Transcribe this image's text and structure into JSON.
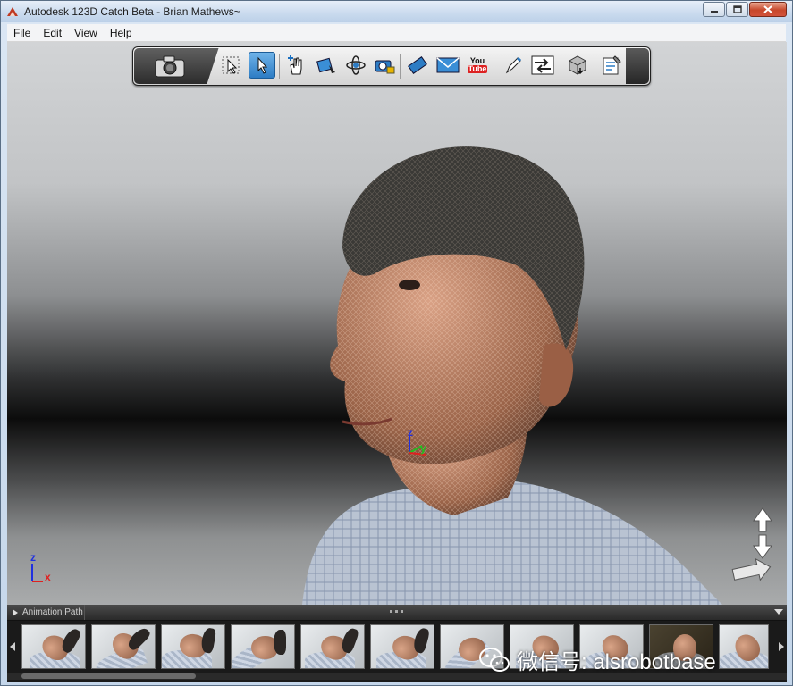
{
  "window": {
    "title": "Autodesk 123D Catch Beta - Brian Mathews~"
  },
  "menu": {
    "items": [
      "File",
      "Edit",
      "View",
      "Help"
    ]
  },
  "toolbar": {
    "youtube_top": "You",
    "youtube_bottom": "Tube"
  },
  "axes": {
    "z": "z",
    "y": "y",
    "x": "x"
  },
  "animation_panel": {
    "label": "Animation Path"
  },
  "watermark": {
    "text": "微信号: alsrobotbase"
  },
  "colors": {
    "accent": "#2d7cc4",
    "axis_x": "#e02020",
    "axis_y": "#20c020",
    "axis_z": "#2030e0"
  }
}
